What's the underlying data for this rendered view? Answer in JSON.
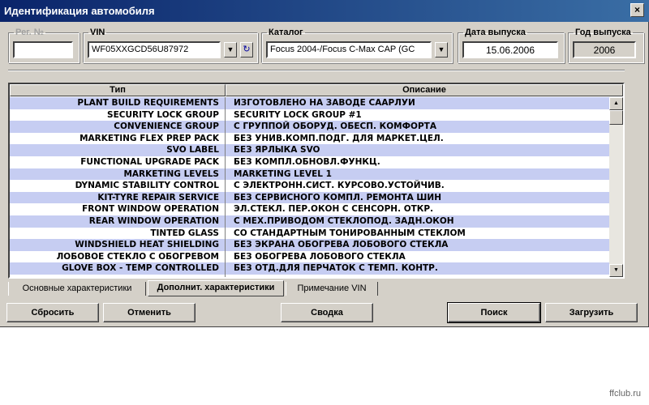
{
  "window": {
    "title": "Идентификация автомобиля",
    "close_glyph": "×"
  },
  "fields": {
    "reg_label": "Рег. №",
    "reg_value": "",
    "vin_label": "VIN",
    "vin_value": "WF05XXGCD56U87972",
    "catalog_label": "Каталог",
    "catalog_value": "Focus 2004-/Focus C-Max CAP (GC",
    "date_label": "Дата выпуска",
    "date_value": "15.06.2006",
    "year_label": "Год выпуска",
    "year_value": "2006"
  },
  "table": {
    "col_type": "Тип",
    "col_desc": "Описание",
    "rows": [
      {
        "type": "PLANT BUILD REQUIREMENTS",
        "desc": "ИЗГОТОВЛЕНО НА ЗАВОДЕ СААРЛУИ"
      },
      {
        "type": "SECURITY LOCK GROUP",
        "desc": "SECURITY LOCK GROUP #1"
      },
      {
        "type": "CONVENIENCE GROUP",
        "desc": "С ГРУППОЙ ОБОРУД. ОБЕСП. КОМФОРТА"
      },
      {
        "type": "MARKETING FLEX PREP PACK",
        "desc": "БЕЗ УНИВ.КОМП.ПОДГ. ДЛЯ МАРКЕТ.ЦЕЛ."
      },
      {
        "type": "SVO LABEL",
        "desc": "БЕЗ ЯРЛЫКА SVO"
      },
      {
        "type": "FUNCTIONAL UPGRADE PACK",
        "desc": "БЕЗ КОМПЛ.ОБНОВЛ.ФУНКЦ."
      },
      {
        "type": "MARKETING LEVELS",
        "desc": "MARKETING LEVEL 1"
      },
      {
        "type": "DYNAMIC STABILITY CONTROL",
        "desc": "С ЭЛЕКТРОНН.СИСТ. КУРСОВО.УСТОЙЧИВ."
      },
      {
        "type": "KIT-TYRE REPAIR SERVICE",
        "desc": "БЕЗ СЕРВИСНОГО КОМПЛ. РЕМОНТА ШИН"
      },
      {
        "type": "FRONT WINDOW OPERATION",
        "desc": "ЭЛ.СТЕКЛ. ПЕР.ОКОН С СЕНСОРН. ОТКР."
      },
      {
        "type": "REAR WINDOW OPERATION",
        "desc": "С МЕХ.ПРИВОДОМ СТЕКЛОПОД. ЗАДН.ОКОН"
      },
      {
        "type": "TINTED GLASS",
        "desc": "СО СТАНДАРТНЫМ ТОНИРОВАННЫМ СТЕКЛОМ"
      },
      {
        "type": "WINDSHIELD HEAT SHIELDING",
        "desc": "БЕЗ ЭКРАНА ОБОГРЕВА ЛОБОВОГО СТЕКЛА"
      },
      {
        "type": "ЛОБОВОЕ СТЕКЛО С ОБОГРЕВОМ",
        "desc": "БЕЗ ОБОГРЕВА ЛОБОВОГО СТЕКЛА"
      },
      {
        "type": "GLOVE BOX - TEMP CONTROLLED",
        "desc": "БЕЗ ОТД.ДЛЯ ПЕРЧАТОК С ТЕМП. КОНТР."
      }
    ]
  },
  "tabs": [
    {
      "label": "Основные характеристики"
    },
    {
      "label": "Дополнит. характеристики"
    },
    {
      "label": "Примечание VIN"
    }
  ],
  "buttons": {
    "reset": "Сбросить",
    "cancel": "Отменить",
    "summary": "Сводка",
    "search": "Поиск",
    "load": "Загрузить"
  },
  "watermark": "ffclub.ru",
  "colors": {
    "title_bar": "#0a246a",
    "row_alt": "#c6cdf2",
    "face": "#d4d0c8"
  }
}
